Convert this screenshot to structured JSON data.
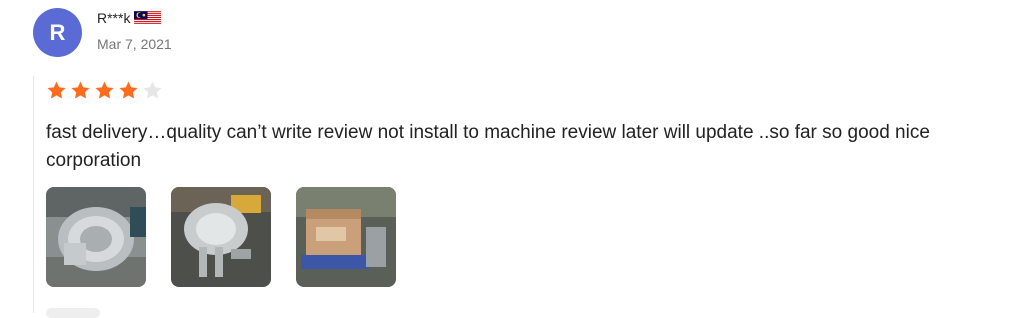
{
  "review": {
    "avatar_initial": "R",
    "reviewer_name": "R***k",
    "country_flag_icon": "malaysia-flag-icon",
    "date": "Mar 7, 2021",
    "rating": 4,
    "rating_max": 5,
    "text": "fast delivery…quality can’t write review not install to machine review later will update ..so far so good nice corporation",
    "photos": [
      {
        "icon": "blower-photo-1"
      },
      {
        "icon": "blower-photo-2"
      },
      {
        "icon": "package-photo-3"
      }
    ]
  },
  "colors": {
    "avatar_bg": "#5a6bd6",
    "star_filled": "#fd6b1c",
    "star_empty": "#e6e6e6"
  }
}
